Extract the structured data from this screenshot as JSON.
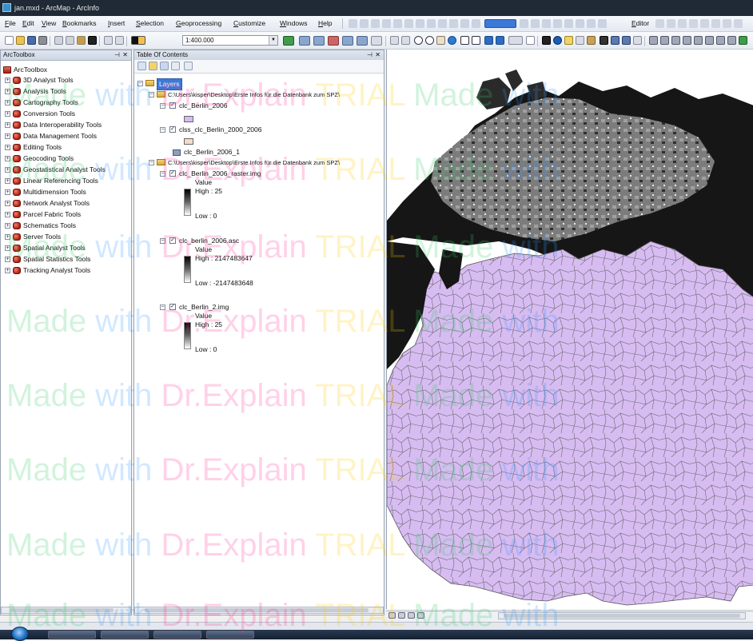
{
  "window": {
    "title": "jan.mxd - ArcMap - ArcInfo"
  },
  "menu": [
    {
      "label": "File"
    },
    {
      "label": "Edit"
    },
    {
      "label": "View"
    },
    {
      "label": "Bookmarks"
    },
    {
      "label": "Insert"
    },
    {
      "label": "Selection"
    },
    {
      "label": "Geoprocessing"
    },
    {
      "label": "Customize"
    },
    {
      "label": "Windows"
    },
    {
      "label": "Help"
    }
  ],
  "editor_label": "Editor",
  "scale_value": "1:400.000",
  "toolbox": {
    "header": "ArcToolbox",
    "root_label": "ArcToolbox",
    "items": [
      {
        "label": "3D Analyst Tools"
      },
      {
        "label": "Analysis Tools"
      },
      {
        "label": "Cartography Tools"
      },
      {
        "label": "Conversion Tools"
      },
      {
        "label": "Data Interoperability Tools"
      },
      {
        "label": "Data Management Tools"
      },
      {
        "label": "Editing Tools"
      },
      {
        "label": "Geocoding Tools"
      },
      {
        "label": "Geostatistical Analyst Tools"
      },
      {
        "label": "Linear Referencing Tools"
      },
      {
        "label": "Multidimension Tools"
      },
      {
        "label": "Network Analyst Tools"
      },
      {
        "label": "Parcel Fabric Tools"
      },
      {
        "label": "Schematics Tools"
      },
      {
        "label": "Server Tools"
      },
      {
        "label": "Spatial Analyst Tools"
      },
      {
        "label": "Spatial Statistics Tools"
      },
      {
        "label": "Tracking Analyst Tools"
      }
    ]
  },
  "toc": {
    "header": "Table Of Contents",
    "layers_label": "Layers",
    "folder1": "C:\\Users\\kisper\\Desktop\\Erste Infos für die Datenbank zum SPZ\\",
    "layer1": "clc_Berlin_2006",
    "layer2": "clss_clc_Berlin_2000_2006",
    "layer3": "clc_Berlin_2006_1",
    "folder2": "C:\\Users\\kisper\\Desktop\\Erste Infos für die Datenbank zum SPZ\\",
    "raster1": {
      "name": "clc_Berlin_2006_raster.img",
      "value_label": "Value",
      "high": "High : 25",
      "low": "Low : 0"
    },
    "raster2": {
      "name": "clc_berlin_2006.asc",
      "value_label": "Value",
      "high": "High : 2147483647",
      "low": "Low : -2147483648"
    },
    "raster3": {
      "name": "clc_Berlin_2.img",
      "value_label": "Value",
      "high": "High : 25",
      "low": "Low : 0"
    }
  },
  "colors": {
    "polygon_fill": "#d7bcf2",
    "polygon_outline": "#555555",
    "layer2_swatch": "#f6dcc8",
    "raster_dark": "#141414",
    "raster_mid": "#7a7a7a"
  },
  "watermark": {
    "part1": "Made",
    "part2": "with",
    "part3": "Dr.Explain",
    "part4": "TRIAL"
  }
}
